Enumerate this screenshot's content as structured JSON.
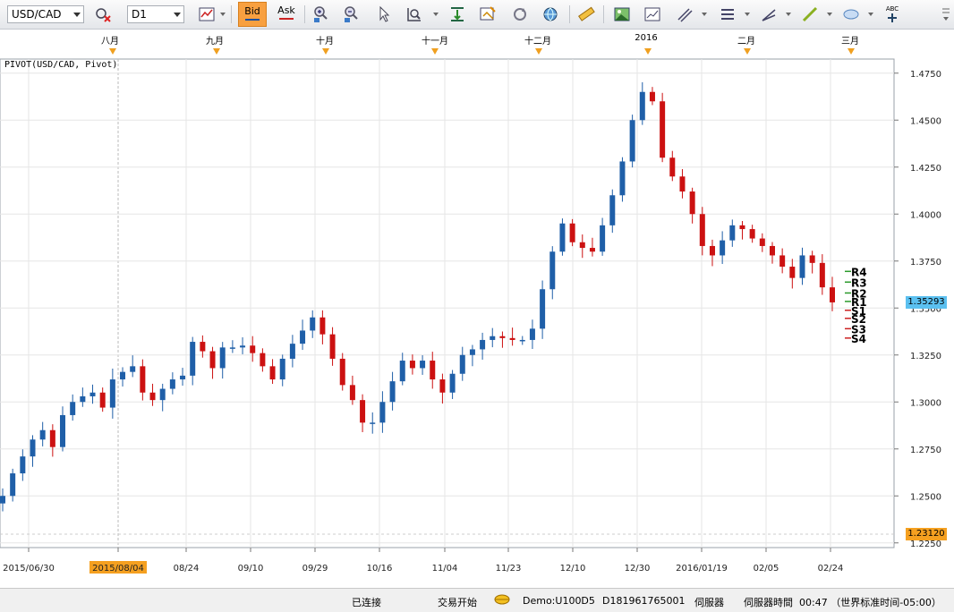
{
  "toolbar": {
    "symbol": "USD/CAD",
    "timeframe": "D1",
    "bid_label": "Bid",
    "ask_label": "Ask",
    "text_tool": "ABC"
  },
  "indicator_title": "PIVOT(USD/CAD, Pivot)",
  "months": [
    "八月",
    "九月",
    "十月",
    "十一月",
    "十二月",
    "2016",
    "二月",
    "三月"
  ],
  "dates": [
    "2015/06/30",
    "2015/08/04",
    "08/24",
    "09/10",
    "09/29",
    "10/16",
    "11/04",
    "11/23",
    "12/10",
    "12/30",
    "2016/01/19",
    "02/05",
    "02/24"
  ],
  "highlighted_date": "2015/08/04",
  "current_price": "1.35293",
  "bottom_price": "1.23120",
  "colors": {
    "up": "#1f5fa8",
    "down": "#cc1111",
    "current_price_bg": "#5bc0f0",
    "bottom_price_bg": "#f5a020",
    "month_marker": "#f0a020"
  },
  "pivot_levels": [
    "R4",
    "R3",
    "R2",
    "R1",
    "S1",
    "S2",
    "S3",
    "S4"
  ],
  "status": {
    "connected": "已连接",
    "trading": "交易开始",
    "account": "Demo:U100D5",
    "account_id": "D181961765001",
    "server": "伺服器",
    "server_time_label": "伺服器時間",
    "server_time": "00:47 （世界标准时间-05:00）"
  },
  "chart_data": {
    "type": "candlestick",
    "title": "PIVOT(USD/CAD, Pivot)",
    "y_ticks": [
      1.225,
      1.25,
      1.275,
      1.3,
      1.325,
      1.35,
      1.375,
      1.4,
      1.425,
      1.45,
      1.475
    ],
    "ylim": [
      1.2225,
      1.4825
    ],
    "x_tick_labels": [
      "2015/06/30",
      "2015/08/04",
      "08/24",
      "09/10",
      "09/29",
      "10/16",
      "11/04",
      "11/23",
      "12/10",
      "12/30",
      "2016/01/19",
      "02/05",
      "02/24"
    ],
    "grid": true,
    "series": [
      {
        "name": "USD/CAD D1",
        "close_path": [
          1.25,
          1.262,
          1.271,
          1.28,
          1.285,
          1.276,
          1.293,
          1.3,
          1.303,
          1.305,
          1.297,
          1.312,
          1.316,
          1.319,
          1.305,
          1.301,
          1.307,
          1.312,
          1.314,
          1.332,
          1.327,
          1.318,
          1.329,
          1.329,
          1.33,
          1.326,
          1.319,
          1.312,
          1.323,
          1.331,
          1.338,
          1.345,
          1.336,
          1.323,
          1.309,
          1.301,
          1.289,
          1.289,
          1.3,
          1.311,
          1.322,
          1.318,
          1.322,
          1.312,
          1.305,
          1.315,
          1.325,
          1.328,
          1.333,
          1.335,
          1.334,
          1.333,
          1.333,
          1.339,
          1.36,
          1.38,
          1.395,
          1.385,
          1.382,
          1.38,
          1.394,
          1.41,
          1.428,
          1.45,
          1.465,
          1.46,
          1.43,
          1.42,
          1.412,
          1.4,
          1.383,
          1.378,
          1.386,
          1.394,
          1.392,
          1.387,
          1.383,
          1.378,
          1.372,
          1.366,
          1.378,
          1.374,
          1.361,
          1.353
        ]
      },
      {
        "name": "Pivot levels",
        "labels": [
          "R4",
          "R3",
          "R2",
          "R1",
          "S1",
          "S2",
          "S3",
          "S4"
        ],
        "values": [
          1.3695,
          1.3638,
          1.358,
          1.3535,
          1.3488,
          1.3445,
          1.339,
          1.334
        ]
      }
    ]
  }
}
